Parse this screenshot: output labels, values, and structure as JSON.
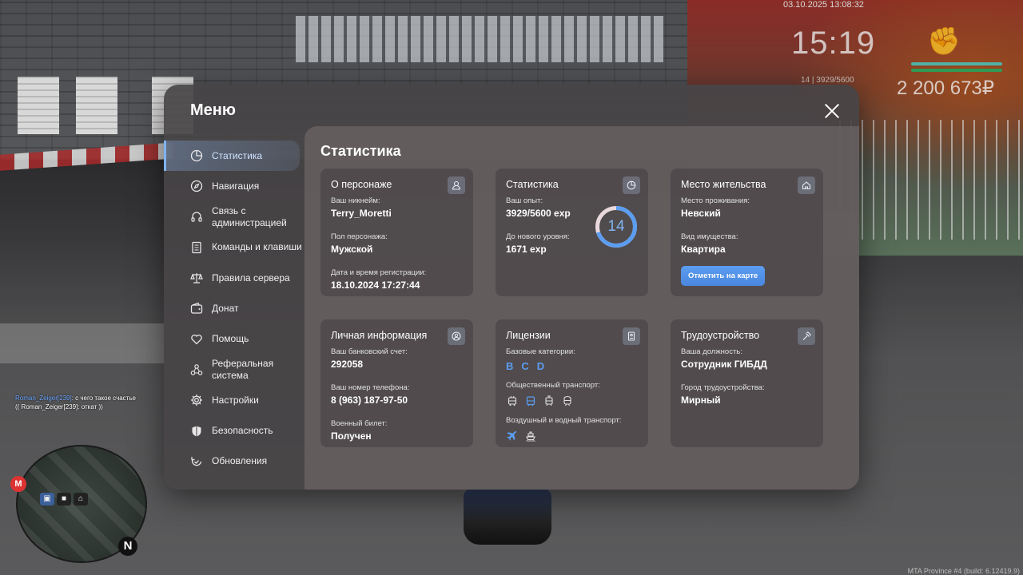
{
  "hud": {
    "datetime": "03.10.2025 13:08:32",
    "clock": "15:19",
    "xp": "14 | 3929/5600",
    "money": "2 200 673₽",
    "build": "MTA Province #4 (build: 6.12419.9)"
  },
  "chat": [
    {
      "nick": "Roman_Zeiger[239]",
      "text": ": с чего такое счастье"
    },
    {
      "nick": "",
      "text": "(( Roman_Zeiger[239]: откат ))"
    }
  ],
  "minimap": {
    "metro": "M",
    "north": "N"
  },
  "menu": {
    "title": "Меню",
    "sidebar": [
      {
        "label": "Статистика",
        "icon": "pie-chart-icon",
        "active": true
      },
      {
        "label": "Навигация",
        "icon": "compass-icon"
      },
      {
        "label": "Связь с администрацией",
        "icon": "headset-icon"
      },
      {
        "label": "Команды и клавиши",
        "icon": "document-icon"
      },
      {
        "label": "Правила сервера",
        "icon": "scales-icon"
      },
      {
        "label": "Донат",
        "icon": "wallet-icon"
      },
      {
        "label": "Помощь",
        "icon": "heart-hands-icon"
      },
      {
        "label": "Реферальная система",
        "icon": "network-icon"
      },
      {
        "label": "Настройки",
        "icon": "gear-icon"
      },
      {
        "label": "Безопасность",
        "icon": "shield-icon"
      },
      {
        "label": "Обновления",
        "icon": "refresh-check-icon"
      }
    ],
    "content_title": "Статистика",
    "cards": {
      "character": {
        "title": "О персонаже",
        "nick_label": "Ваш никнейм:",
        "nick": "Terry_Moretti",
        "gender_label": "Пол персонажа:",
        "gender": "Мужской",
        "reg_label": "Дата и время регистрации:",
        "reg": "18.10.2024 17:27:44"
      },
      "stats": {
        "title": "Статистика",
        "exp_label": "Ваш опыт:",
        "exp": "3929/5600 exp",
        "next_label": "До нового уровня:",
        "next": "1671 exp",
        "level": "14",
        "progress": 0.7016
      },
      "residence": {
        "title": "Место жительства",
        "place_label": "Место проживания:",
        "place": "Невский",
        "type_label": "Вид имущества:",
        "type": "Квартира",
        "button": "Отметить на карте"
      },
      "personal": {
        "title": "Личная информация",
        "bank_label": "Ваш банковский счет:",
        "bank": "292058",
        "phone_label": "Ваш номер телефона:",
        "phone": "8 (963) 187-97-50",
        "military_label": "Военный билет:",
        "military": "Получен"
      },
      "licenses": {
        "title": "Лицензии",
        "base_label": "Базовые категории:",
        "base": [
          "B",
          "C",
          "D"
        ],
        "public_label": "Общественный транспорт:",
        "public_icons": [
          "trolleybus-icon",
          "bus-icon",
          "tram-icon",
          "metro-train-icon"
        ],
        "air_label": "Воздушный и водный транспорт:",
        "air_icons": [
          "airplane-icon",
          "boat-icon"
        ]
      },
      "job": {
        "title": "Трудоустройство",
        "position_label": "Ваша должность:",
        "position": "Сотрудник ГИБДД",
        "city_label": "Город трудоустройства:",
        "city": "Мирный"
      }
    }
  },
  "colors": {
    "accent": "#5b9df0",
    "ring_track": "#e9d9dc"
  }
}
